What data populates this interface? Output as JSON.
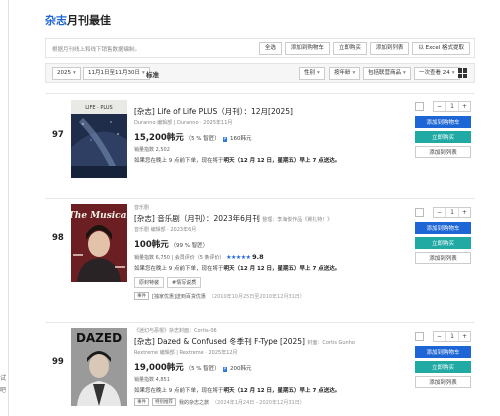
{
  "page": {
    "title_accent": "杂志",
    "title_rest": "月刊最佳"
  },
  "left_edge": {
    "line1": "试",
    "line2": "吧"
  },
  "toolbar": {
    "description": "根据月刊线上和线下销售数据编制。",
    "buttons": [
      "全选",
      "添加到购物车",
      "立即购买",
      "添加到列表",
      "以 Excel 格式提取"
    ]
  },
  "filter": {
    "year": "2025",
    "date_range": "11月1日至11月30日",
    "standard": "标准",
    "sort1": "性别",
    "sort2": "按年龄",
    "sort3": "包括联营商品",
    "per_page": "一次查看 24"
  },
  "icons": {
    "dropdown": "chevron-down-icon",
    "grid_view": "grid-view-icon"
  },
  "items": [
    {
      "rank": "97",
      "publisher_line": "",
      "tag": "[杂志]",
      "title": "Life of Life PLUS（月刊）：12月[2025]",
      "meta": "Duranno 编辑部 | Duranno · 2025年11月",
      "price": "15,200韩元",
      "discount": "（5 % 智匠）",
      "points": "160韩元",
      "sales": "销量指数 2,502",
      "rating": "",
      "shipping_pre": "如果您在晚上 9 点前下单，现在将于",
      "shipping_bold": "明天（12 月 12 日，星期五）早上 7 点送达。",
      "event_tag": "",
      "event_text": "",
      "event_date": "",
      "cover_title": "",
      "colors": {
        "cover_bg": "#1f2d4a"
      }
    },
    {
      "rank": "98",
      "publisher_line": "音乐剧",
      "tag": "[杂志]",
      "title": "音乐剧（月刊）：2023年6月刊",
      "title_extra": "整理：李海俊作品《冀扎特！》",
      "meta": "音乐剧 编辑部 · 2023年6月",
      "price": "100韩元",
      "discount": "（99 % 智匠）",
      "points": "",
      "sales": "销量指数 6,750 | 会员评价（5 条评价）",
      "stars": "★★★★★",
      "rating": "9.8",
      "shipping_pre": "如果您在晚上 9 点前下单，现在将于",
      "shipping_bold": "明天（12 月 12 日，星期五）早上 7 点送达。",
      "tags": [
        "原封特装",
        "#情写说质"
      ],
      "event_tag": "事件",
      "event_text": "[独家优惠]送到百货优惠",
      "event_date": "（2010年10月25日至2010年12月31日）",
      "cover_title": "The Musical",
      "colors": {
        "cover_bg": "#6b1f22"
      }
    },
    {
      "rank": "99",
      "publisher_line": "《迷幻与恶棍》杂志封面：Cortis-06",
      "tag": "[杂志]",
      "title": "Dazed & Confused 冬季刊 F-Type [2025]",
      "title_extra": "封面：Cortis Gunho",
      "meta": "Rextreme 编辑部 | Rextreme · 2025年12月",
      "price": "19,000韩元",
      "discount": "（5 % 智匠）",
      "points": "200韩元",
      "sales": "销量指数 4,851",
      "rating": "",
      "shipping_pre": "如果您在晚上 9 点前下单，现在将于",
      "shipping_bold": "明天（12 月 12 日，星期五）早上 7 点送达。",
      "event_tag": "事件",
      "event_tag2": "特别推荐",
      "event_text": "我的杂志之旅",
      "event_date": "（2024年1月24日 - 2020年12月31日）",
      "cover_title": "DAZED",
      "colors": {
        "cover_bg": "#9a9a9a"
      }
    }
  ],
  "item_actions": {
    "qty": "1",
    "minus": "−",
    "plus": "+",
    "cart": "添加到购物车",
    "buy": "立即购买",
    "list": "添加到列表"
  },
  "colors": {
    "accent": "#1e66d6",
    "buy": "#21a9a4"
  }
}
